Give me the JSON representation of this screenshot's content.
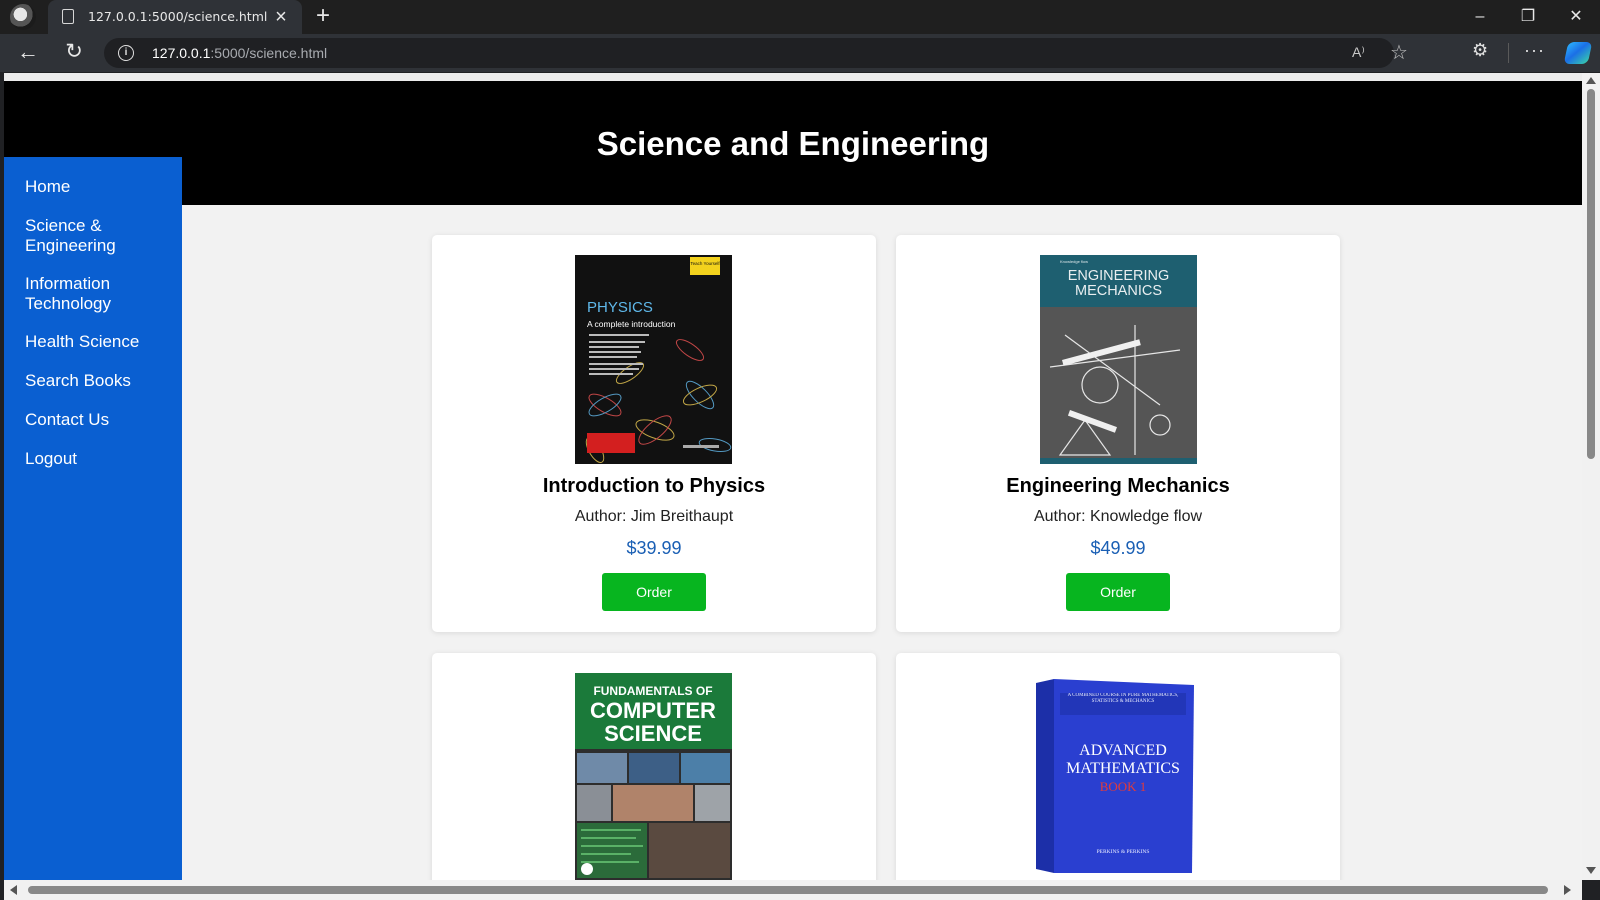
{
  "browser": {
    "tab_title": "127.0.0.1:5000/science.html",
    "url_host": "127.0.0.1",
    "url_path": ":5000/science.html"
  },
  "icons": {
    "tab_close": "×",
    "new_tab": "+",
    "minimize": "–",
    "restore": "❐",
    "close": "✕",
    "back": "←",
    "reload": "↻",
    "site_info": "i",
    "read_aloud": "A⁾",
    "favorite": "☆",
    "extensions": "⚙",
    "menu": "···"
  },
  "header": {
    "title": "Science and Engineering"
  },
  "sidebar": {
    "items": [
      {
        "label": "Home"
      },
      {
        "label": "Science & Engineering"
      },
      {
        "label": "Information Technology"
      },
      {
        "label": "Health Science"
      },
      {
        "label": "Search Books"
      },
      {
        "label": "Contact Us"
      },
      {
        "label": "Logout"
      }
    ]
  },
  "books": [
    {
      "title": "Introduction to Physics",
      "author": "Author: Jim Breithaupt",
      "price": "$39.99",
      "order_label": "Order",
      "cover": {
        "heading": "PHYSICS",
        "subheading": "A complete introduction",
        "badge": "Teach Yourself"
      }
    },
    {
      "title": "Engineering Mechanics",
      "author": "Author: Knowledge flow",
      "price": "$49.99",
      "order_label": "Order",
      "cover": {
        "heading": "ENGINEERING MECHANICS",
        "publisher": "Knowledge flow"
      }
    },
    {
      "cover": {
        "line1": "FUNDAMENTALS OF",
        "line2": "COMPUTER",
        "line3": "SCIENCE"
      }
    },
    {
      "cover": {
        "series": "A COMBINED COURSE IN PURE MATHEMATICS, STATISTICS & MECHANICS",
        "line1": "ADVANCED",
        "line2": "MATHEMATICS",
        "line3": "BOOK 1",
        "authors": "PERKINS & PERKINS"
      }
    }
  ],
  "colors": {
    "header_bg": "#000000",
    "sidebar_bg": "#0a5fd1",
    "order_button": "#07b51f",
    "price_text": "#1a5fb4"
  }
}
